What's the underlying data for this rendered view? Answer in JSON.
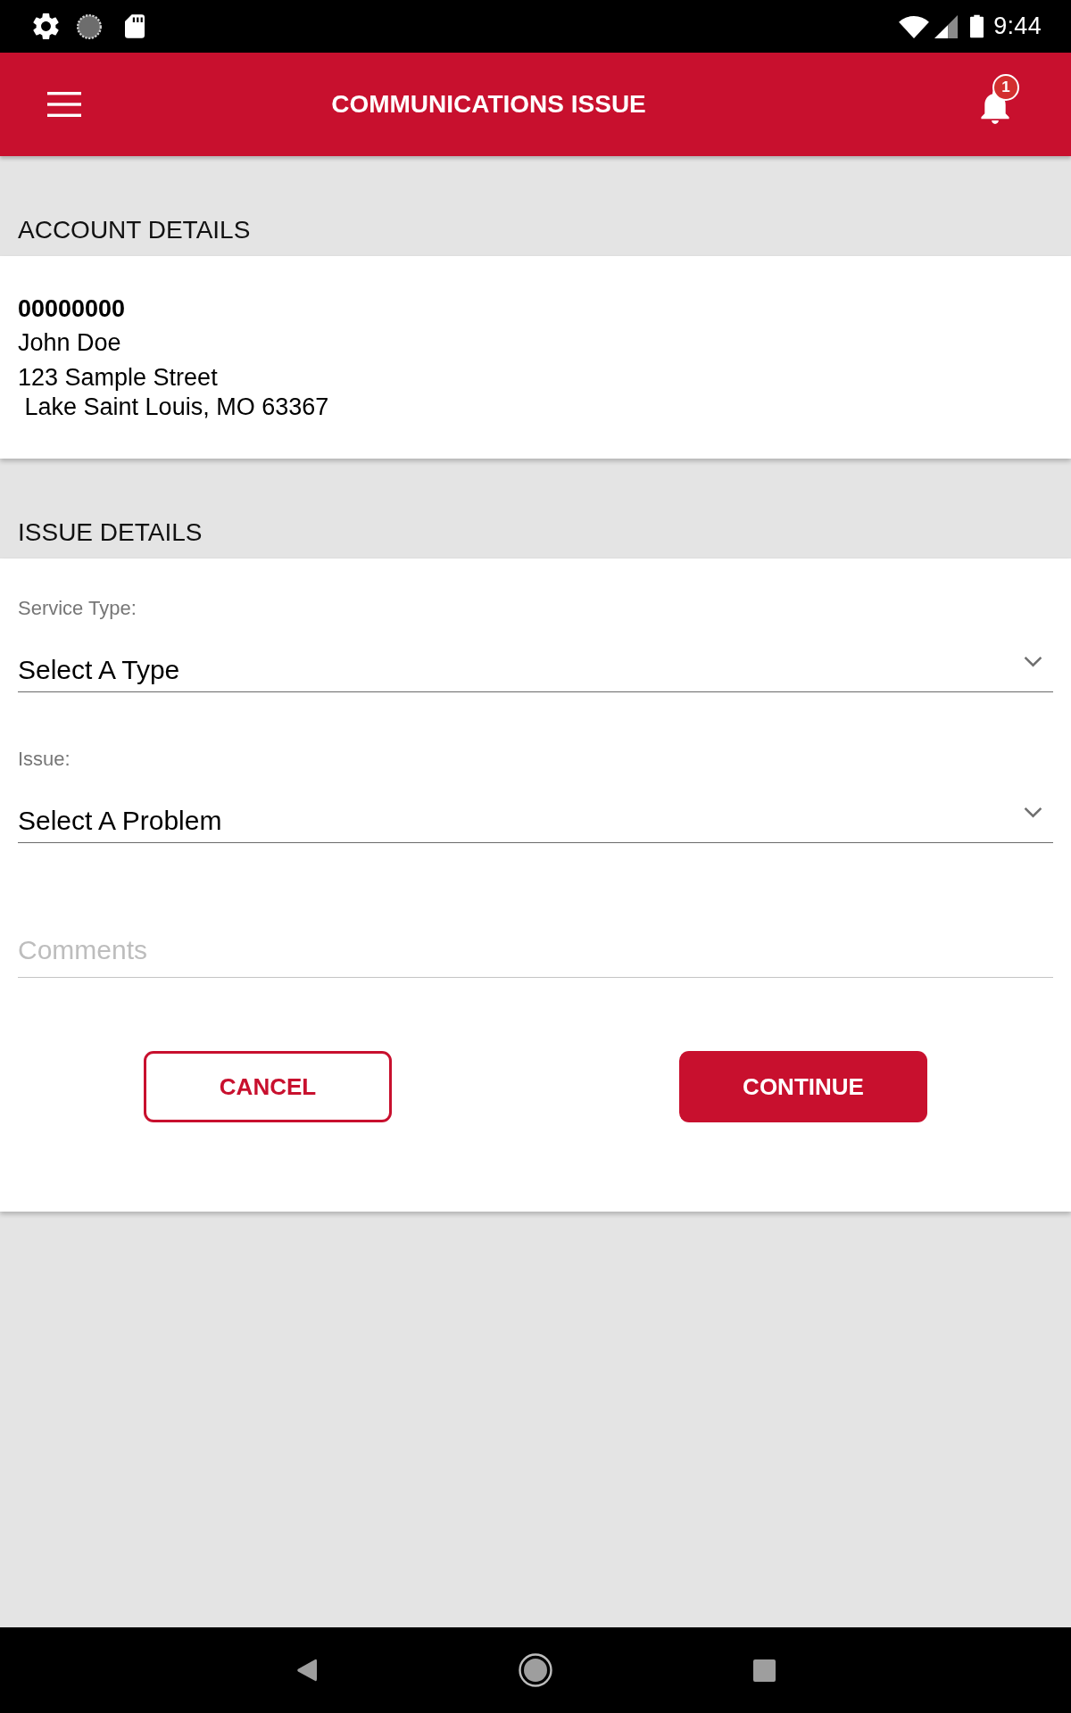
{
  "status_bar": {
    "time": "9:44"
  },
  "header": {
    "title": "COMMUNICATIONS ISSUE",
    "notification_count": "1"
  },
  "sections": [
    {
      "kind": "account",
      "heading": "ACCOUNT DETAILS",
      "account_number": "00000000",
      "name": "John Doe",
      "address_lines": [
        "123 Sample Street",
        " Lake Saint Louis, MO 63367"
      ]
    },
    {
      "kind": "form",
      "heading": "ISSUE DETAILS",
      "fields": [
        {
          "kind": "dropdown",
          "label": "Service Type:",
          "value": "Select A Type"
        },
        {
          "kind": "dropdown",
          "label": "Issue:",
          "value": "Select A Problem"
        },
        {
          "kind": "text",
          "placeholder": "Comments"
        }
      ],
      "buttons": [
        {
          "kind": "outline",
          "label": "CANCEL"
        },
        {
          "kind": "filled",
          "label": "CONTINUE"
        }
      ]
    }
  ]
}
